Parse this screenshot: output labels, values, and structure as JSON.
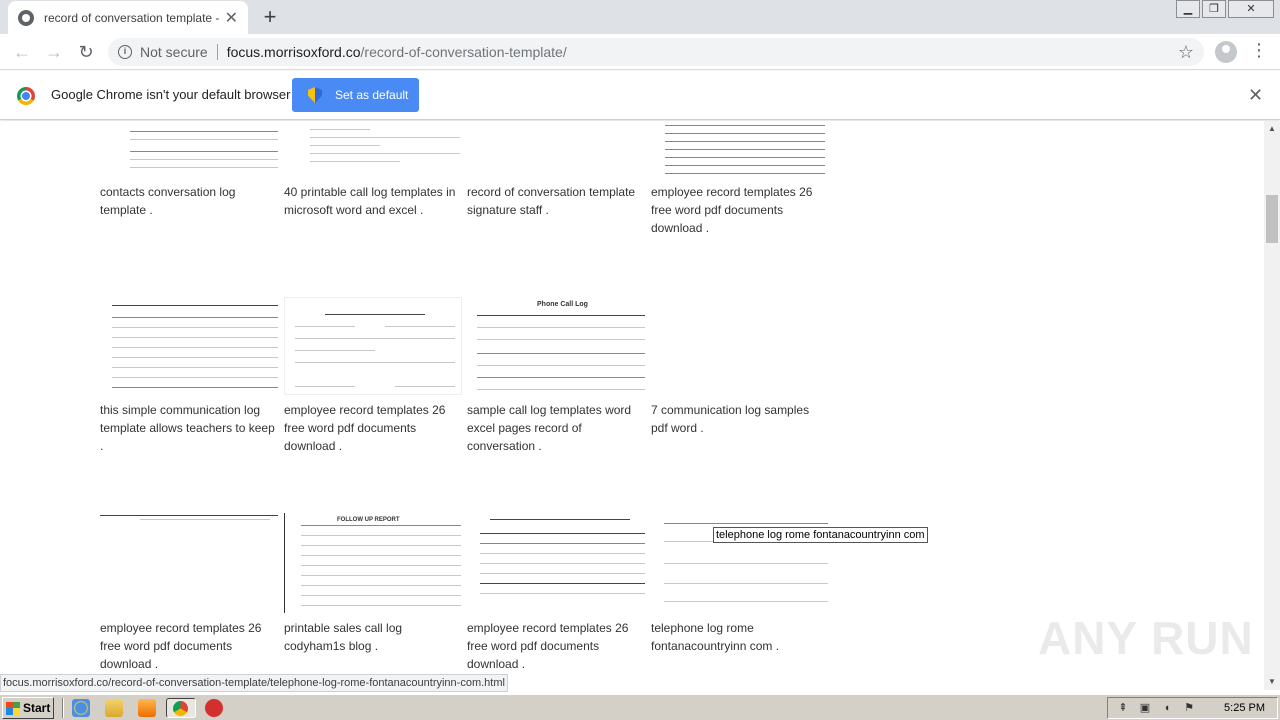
{
  "tab": {
    "title": "record of conversation template - Fo"
  },
  "omnibox": {
    "security_label": "Not secure",
    "host": "focus.morrisoxford.co",
    "path": "/record-of-conversation-template/"
  },
  "infobar": {
    "message": "Google Chrome isn't your default browser",
    "button_label": "Set as default"
  },
  "captions": [
    "contacts conversation log template .",
    "40 printable call log templates in microsoft word and excel .",
    "record of conversation template signature staff .",
    "employee record templates 26 free word pdf documents download .",
    "this simple communication log template allows teachers to keep .",
    "employee record templates 26 free word pdf documents download .",
    "sample call log templates word excel pages record of conversation .",
    "7 communication log samples pdf word .",
    "employee record templates 26 free word pdf documents download .",
    "printable sales call log codyham1s blog .",
    "employee record templates 26 free word pdf documents download .",
    "telephone log rome fontanacountryinn com ."
  ],
  "thumb_titles": {
    "t5": "Phone Call Log",
    "t9": "FOLLOW UP REPORT"
  },
  "tooltip": "telephone log rome fontanacountryinn com",
  "status_url": "focus.morrisoxford.co/record-of-conversation-template/telephone-log-rome-fontanacountryinn-com.html",
  "watermark": "ANY RUN",
  "taskbar": {
    "start_label": "Start",
    "clock": "5:25 PM"
  },
  "icons": {
    "back": "arrow-left-icon",
    "forward": "arrow-right-icon",
    "reload": "reload-icon",
    "star": "star-icon",
    "menu": "kebab-menu-icon"
  },
  "colors": {
    "accent_button": "#4a8af4",
    "titlebar": "#dee1e6",
    "taskbar": "#d4d0c8"
  }
}
